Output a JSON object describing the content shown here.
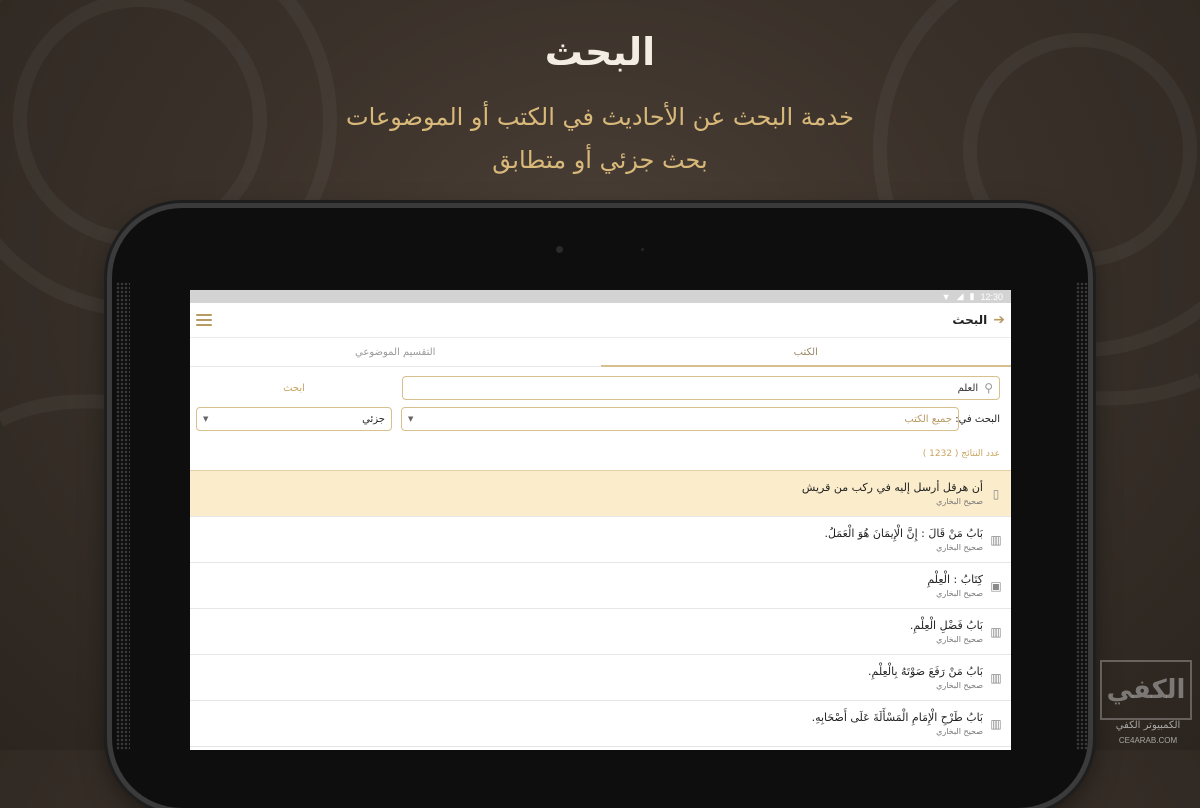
{
  "header": {
    "title": "البحث",
    "subtitle_line1": "خدمة البحث عن الأحاديث في الكتب أو الموضوعات",
    "subtitle_line2": "بحث جزئي أو متطابق"
  },
  "status_bar": {
    "time": "12:30",
    "icons": [
      "wifi-icon",
      "signal-icon",
      "battery-icon"
    ]
  },
  "app_bar": {
    "title": "البحث",
    "back_icon": "arrow-icon",
    "menu_icon": "hamburger-icon"
  },
  "tabs": [
    {
      "label": "الكتب",
      "active": true
    },
    {
      "label": "التقسيم الموضوعي",
      "active": false
    }
  ],
  "search": {
    "value": "العلم",
    "button_label": "ابحث",
    "search_in_label": "البحث في:",
    "books_select_value": "جميع الكتب",
    "mode_select_value": "جزئي",
    "results_count_text": "عدد النتائج ( 1232 )"
  },
  "results": [
    {
      "title": "أن هرقل أرسل إليه في ركب من قريش",
      "source": "صحيح البخاري",
      "icon": "document-icon",
      "highlighted": true
    },
    {
      "title": "بَابُ مَنْ قَالَ : إِنَّ الْإِيمَانَ هُوَ الْعَمَلُ.",
      "source": "صحيح البخاري",
      "icon": "open-book-icon",
      "highlighted": false
    },
    {
      "title": "كِتَابُ : الْعِلْمِ",
      "source": "صحيح البخاري",
      "icon": "book-icon",
      "highlighted": false
    },
    {
      "title": "بَابُ فَضْلِ الْعِلْمِ.",
      "source": "صحيح البخاري",
      "icon": "open-book-icon",
      "highlighted": false
    },
    {
      "title": "بَابُ مَنْ رَفَعَ صَوْتَهُ بِالْعِلْمِ.",
      "source": "صحيح البخاري",
      "icon": "open-book-icon",
      "highlighted": false
    },
    {
      "title": "بَابُ طَرْحِ الْإِمَامِ الْمَسْأَلَةَ عَلَى أَصْحَابِهِ.",
      "source": "صحيح البخاري",
      "icon": "open-book-icon",
      "highlighted": false
    }
  ],
  "watermark": {
    "name": "الكمبيوتر الكفي",
    "url": "CE4ARAB.COM"
  },
  "colors": {
    "accent_gold": "#d8c08e",
    "highlight_row": "#fbeccb",
    "subtitle": "#d9b97a"
  }
}
